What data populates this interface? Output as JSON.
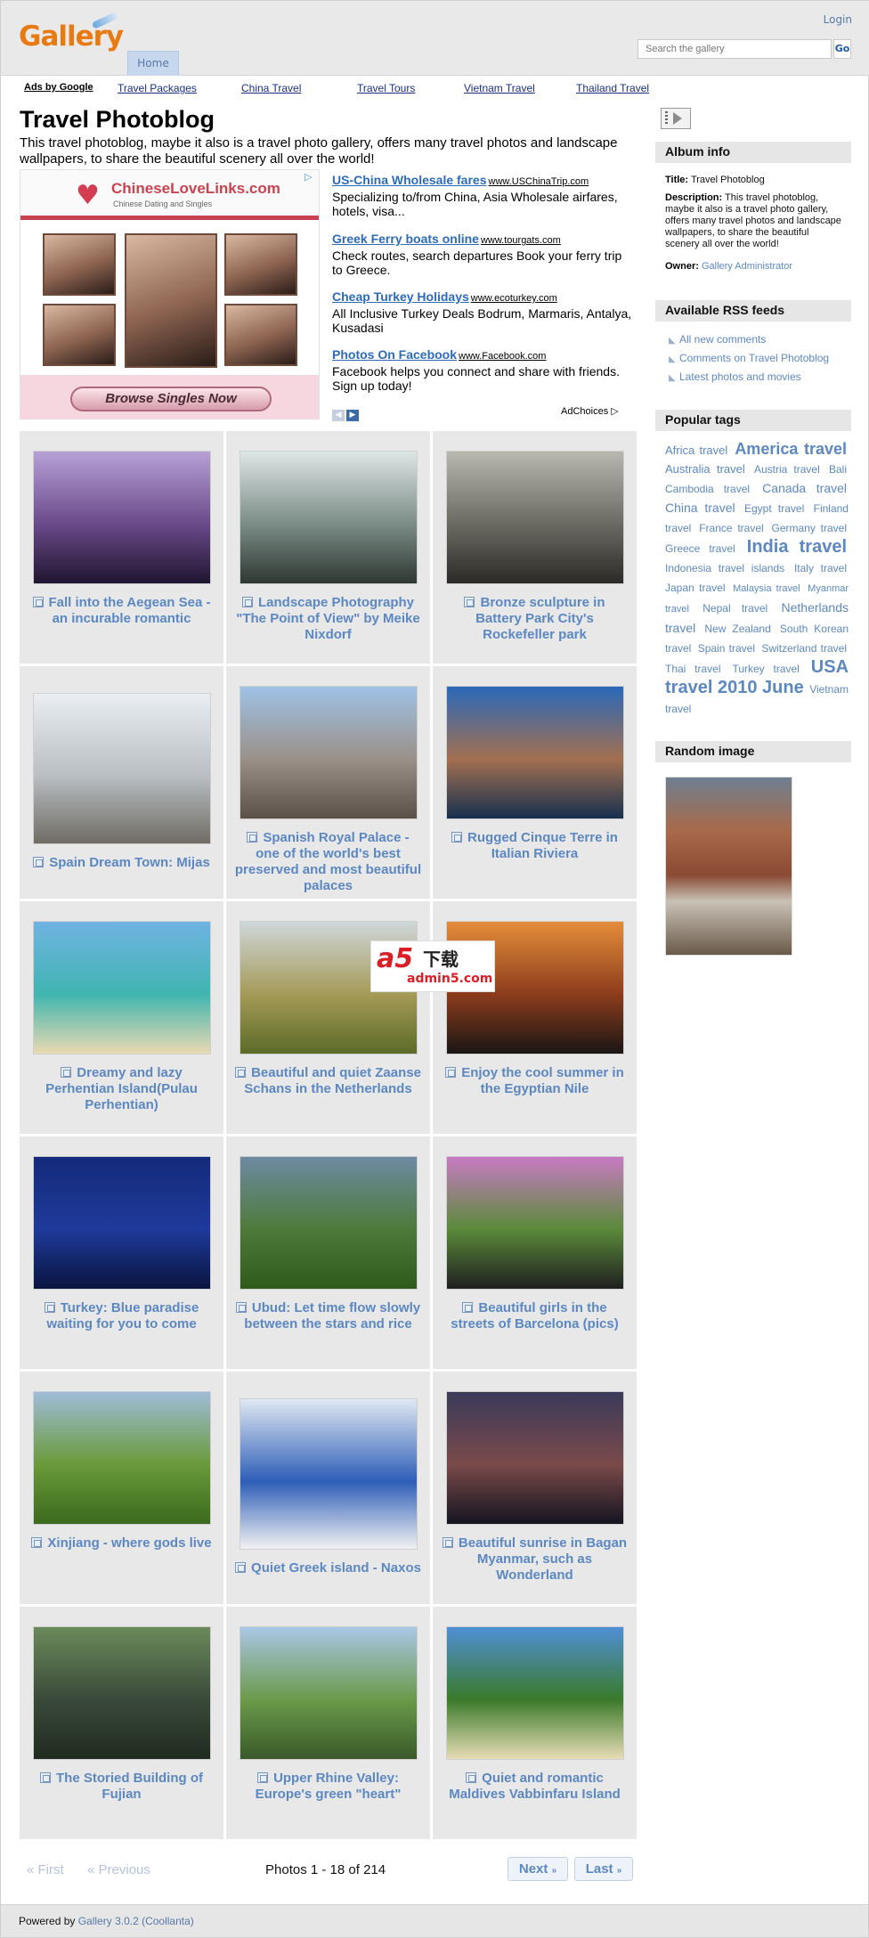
{
  "header": {
    "logo_text": "Gallery",
    "login_label": "Login",
    "home_tab": "Home",
    "search_placeholder": "Search the gallery",
    "search_go": "Go"
  },
  "ad_bar": {
    "ads_label": "Ads by Google",
    "links": [
      "Travel Packages",
      "China Travel",
      "Travel Tours",
      "Vietnam Travel",
      "Thailand Travel"
    ]
  },
  "album": {
    "title": "Travel Photoblog",
    "description": "This travel photoblog, maybe it also is a travel photo gallery, offers many travel photos and landscape wallpapers, to share the beautiful scenery all over the world!"
  },
  "image_ad": {
    "brand": "ChineseLoveLinks.com",
    "tagline": "Chinese Dating and Singles",
    "button": "Browse Singles Now"
  },
  "text_ads": [
    {
      "title": "US-China Wholesale fares",
      "url": "www.USChinaTrip.com",
      "desc": "Specializing to/from China, Asia Wholesale airfares, hotels, visa..."
    },
    {
      "title": "Greek Ferry boats online",
      "url": "www.tourgats.com",
      "desc": "Check routes, search departures Book your ferry trip to Greece."
    },
    {
      "title": "Cheap Turkey Holidays",
      "url": "www.ecoturkey.com",
      "desc": "All Inclusive Turkey Deals Bodrum, Marmaris, Antalya, Kusadasi"
    },
    {
      "title": "Photos On Facebook",
      "url": "www.Facebook.com",
      "desc": "Facebook helps you connect and share with friends. Sign up today!"
    }
  ],
  "adchoices_label": "AdChoices",
  "photos": [
    {
      "caption": "Fall into the Aegean Sea - an incurable romantic",
      "colors": [
        "#b7a1d6",
        "#6a4a8a",
        "#1f1530"
      ]
    },
    {
      "caption": "Landscape Photography \"The Point of View\" by Meike Nixdorf",
      "colors": [
        "#dfe6e6",
        "#7b8c86",
        "#2f3833"
      ]
    },
    {
      "caption": "Bronze sculpture in Battery Park City's Rockefeller park",
      "colors": [
        "#b8b8b0",
        "#6b6a62",
        "#2b2a26"
      ]
    },
    {
      "caption": "Spain Dream Town: Mijas",
      "colors": [
        "#e9eef2",
        "#b9bec2",
        "#6f6c64"
      ]
    },
    {
      "caption": "Spanish Royal Palace - one of the world's best preserved and most beautiful palaces",
      "colors": [
        "#9fc2e6",
        "#9a9088",
        "#5a5048"
      ]
    },
    {
      "caption": "Rugged Cinque Terre in Italian Riviera",
      "colors": [
        "#2a68b8",
        "#a37050",
        "#16304f"
      ]
    },
    {
      "caption": "Dreamy and lazy Perhentian Island(Pulau Perhentian)",
      "colors": [
        "#6fb3e3",
        "#41b5b0",
        "#e9d9b1"
      ]
    },
    {
      "caption": "Beautiful and quiet Zaanse Schans in the Netherlands",
      "colors": [
        "#cfd7da",
        "#a59a58",
        "#5a6b26"
      ]
    },
    {
      "caption": "Enjoy the cool summer in the Egyptian Nile",
      "colors": [
        "#e58d3b",
        "#8c3c1c",
        "#1a1614"
      ]
    },
    {
      "caption": "Turkey: Blue paradise waiting for you to come",
      "colors": [
        "#142a7a",
        "#1e3a9a",
        "#0a1440"
      ]
    },
    {
      "caption": "Ubud: Let time flow slowly between the stars and rice",
      "colors": [
        "#6e8aa3",
        "#4d7a3a",
        "#2e5a1c"
      ]
    },
    {
      "caption": "Beautiful girls in the streets of Barcelona (pics)",
      "colors": [
        "#c77ac2",
        "#5a8a3a",
        "#1f1f1f"
      ]
    },
    {
      "caption": "Xinjiang - where gods live",
      "colors": [
        "#9fbcd8",
        "#6a9a3a",
        "#3a6a1c"
      ]
    },
    {
      "caption": "Quiet Greek island - Naxos",
      "colors": [
        "#dfe8f2",
        "#2e5eb8",
        "#f2f2f2"
      ]
    },
    {
      "caption": "Beautiful sunrise in Bagan Myanmar, such as Wonderland",
      "colors": [
        "#3a3a5a",
        "#7a4a4a",
        "#141420"
      ]
    },
    {
      "caption": "The Storied Building of Fujian",
      "colors": [
        "#6a8a5a",
        "#3a4a3a",
        "#1f2a1f"
      ]
    },
    {
      "caption": "Upper Rhine Valley: Europe's green \"heart\"",
      "colors": [
        "#a9c7e6",
        "#6a9a4a",
        "#3a5a2a"
      ]
    },
    {
      "caption": "Quiet and romantic Maldives Vabbinfaru Island",
      "colors": [
        "#4f8fd6",
        "#3a7a2a",
        "#e8dcb6"
      ]
    }
  ],
  "watermark": {
    "line1": "a5",
    "line2": "下载",
    "line3": "admin5.com"
  },
  "pager": {
    "first": "First",
    "previous": "Previous",
    "count": "Photos 1 - 18 of 214",
    "next": "Next",
    "last": "Last"
  },
  "footer": {
    "prefix": "Powered by",
    "link": "Gallery 3.0.2 (Coollanta)"
  },
  "sidebar": {
    "album_info_head": "Album info",
    "title_label": "Title:",
    "title_value": "Travel Photoblog",
    "desc_label": "Description:",
    "desc_value": "This travel photoblog, maybe it also is a travel photo gallery, offers many travel photos and landscape wallpapers, to share the beautiful scenery all over the world!",
    "owner_label": "Owner:",
    "owner_value": "Gallery Administrator",
    "rss_head": "Available RSS feeds",
    "rss_items": [
      "All new comments",
      "Comments on Travel Photoblog",
      "Latest photos and movies"
    ],
    "tags_head": "Popular tags",
    "tags": [
      {
        "t": "Africa travel",
        "s": 13
      },
      {
        "t": "America travel",
        "s": 18
      },
      {
        "t": "Australia travel",
        "s": 13
      },
      {
        "t": "Austria travel",
        "s": 12
      },
      {
        "t": "Bali",
        "s": 12
      },
      {
        "t": "Cambodia travel",
        "s": 12
      },
      {
        "t": "Canada travel",
        "s": 14
      },
      {
        "t": "China travel",
        "s": 14
      },
      {
        "t": "Egypt travel",
        "s": 12
      },
      {
        "t": "Finland travel",
        "s": 12
      },
      {
        "t": "France travel",
        "s": 12
      },
      {
        "t": "Germany travel",
        "s": 12
      },
      {
        "t": "Greece travel",
        "s": 12
      },
      {
        "t": "India travel",
        "s": 20
      },
      {
        "t": "Indonesia travel islands",
        "s": 12
      },
      {
        "t": "Italy travel",
        "s": 12
      },
      {
        "t": "Japan travel",
        "s": 12
      },
      {
        "t": "Malaysia travel",
        "s": 11
      },
      {
        "t": "Myanmar travel",
        "s": 11
      },
      {
        "t": "Nepal travel",
        "s": 12
      },
      {
        "t": "Netherlands travel",
        "s": 14
      },
      {
        "t": "New Zealand",
        "s": 12
      },
      {
        "t": "South Korean travel",
        "s": 12
      },
      {
        "t": "Spain travel",
        "s": 12
      },
      {
        "t": "Switzerland travel",
        "s": 12
      },
      {
        "t": "Thai travel",
        "s": 12
      },
      {
        "t": "Turkey travel",
        "s": 12
      },
      {
        "t": "USA travel 2010 June",
        "s": 20
      },
      {
        "t": "Vietnam travel",
        "s": 12
      }
    ],
    "random_head": "Random image"
  }
}
